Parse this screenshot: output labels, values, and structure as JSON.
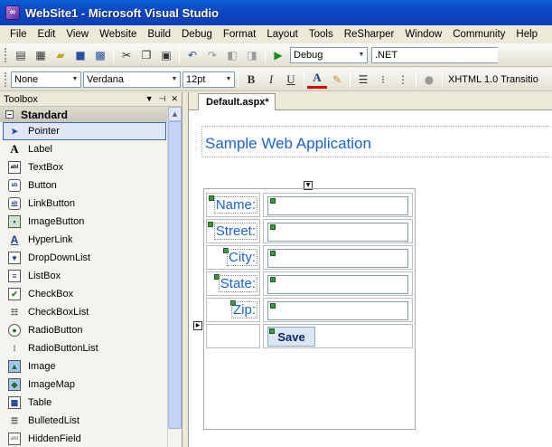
{
  "window": {
    "title": "WebSite1 - Microsoft Visual Studio"
  },
  "menu": [
    "File",
    "Edit",
    "View",
    "Website",
    "Build",
    "Debug",
    "Format",
    "Layout",
    "Tools",
    "ReSharper",
    "Window",
    "Community",
    "Help"
  ],
  "toolbar1": {
    "config": "Debug",
    "platform": ".NET"
  },
  "toolbar2": {
    "style": "None",
    "font": "Verdana",
    "size": "12pt",
    "doctype": "XHTML 1.0 Transitio"
  },
  "toolbox": {
    "title": "Toolbox",
    "category": "Standard",
    "items": [
      {
        "label": "Pointer",
        "icon": "pointer-icon"
      },
      {
        "label": "Label",
        "icon": "label-icon"
      },
      {
        "label": "TextBox",
        "icon": "textbox-icon"
      },
      {
        "label": "Button",
        "icon": "button-icon"
      },
      {
        "label": "LinkButton",
        "icon": "linkbutton-icon"
      },
      {
        "label": "ImageButton",
        "icon": "imagebutton-icon"
      },
      {
        "label": "HyperLink",
        "icon": "hyperlink-icon"
      },
      {
        "label": "DropDownList",
        "icon": "dropdownlist-icon"
      },
      {
        "label": "ListBox",
        "icon": "listbox-icon"
      },
      {
        "label": "CheckBox",
        "icon": "checkbox-icon"
      },
      {
        "label": "CheckBoxList",
        "icon": "checkboxlist-icon"
      },
      {
        "label": "RadioButton",
        "icon": "radiobutton-icon"
      },
      {
        "label": "RadioButtonList",
        "icon": "radiobuttonlist-icon"
      },
      {
        "label": "Image",
        "icon": "image-icon"
      },
      {
        "label": "ImageMap",
        "icon": "imagemap-icon"
      },
      {
        "label": "Table",
        "icon": "table-icon"
      },
      {
        "label": "BulletedList",
        "icon": "bulletedlist-icon"
      },
      {
        "label": "HiddenField",
        "icon": "hiddenfield-icon"
      }
    ]
  },
  "document": {
    "tab": "Default.aspx*",
    "heading": "Sample Web Application",
    "fields": [
      "Name:",
      "Street:",
      "City:",
      "State:",
      "Zip:"
    ],
    "button": "Save"
  }
}
